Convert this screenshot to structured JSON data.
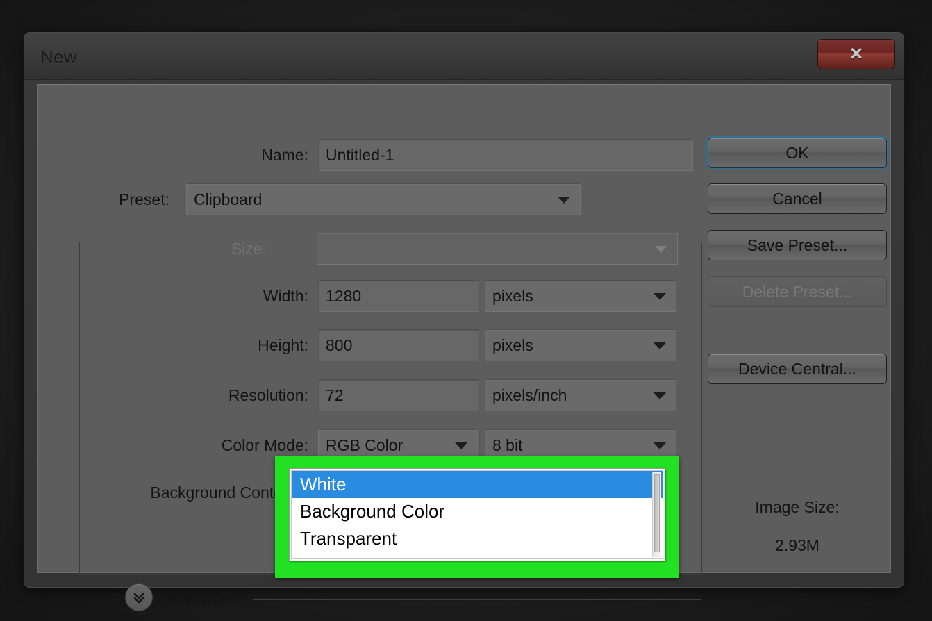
{
  "window": {
    "title": "New",
    "close_glyph": "✕",
    "close_name": "close"
  },
  "form": {
    "name": {
      "label": "Name:",
      "value": "Untitled-1"
    },
    "preset": {
      "label": "Preset:",
      "value": "Clipboard"
    },
    "size": {
      "label": "Size:",
      "value": "",
      "disabled": true
    },
    "width": {
      "label": "Width:",
      "value": "1280",
      "unit": "pixels"
    },
    "height": {
      "label": "Height:",
      "value": "800",
      "unit": "pixels"
    },
    "resolution": {
      "label": "Resolution:",
      "value": "72",
      "unit": "pixels/inch"
    },
    "color_mode": {
      "label": "Color Mode:",
      "value": "RGB Color",
      "depth": "8 bit"
    },
    "background_contents": {
      "label": "Background Contents:",
      "value": "White"
    }
  },
  "advanced": {
    "label": "Advanced",
    "icon": "double-chevron-down-icon"
  },
  "buttons": {
    "ok": "OK",
    "cancel": "Cancel",
    "save_preset": "Save Preset...",
    "delete_preset": "Delete Preset...",
    "device_central": "Device Central..."
  },
  "image_size": {
    "label": "Image Size:",
    "value": "2.93M"
  },
  "dropdown": {
    "open": true,
    "highlight_color": "#22e022",
    "selected_index": 0,
    "options": [
      "White",
      "Background Color",
      "Transparent"
    ]
  }
}
